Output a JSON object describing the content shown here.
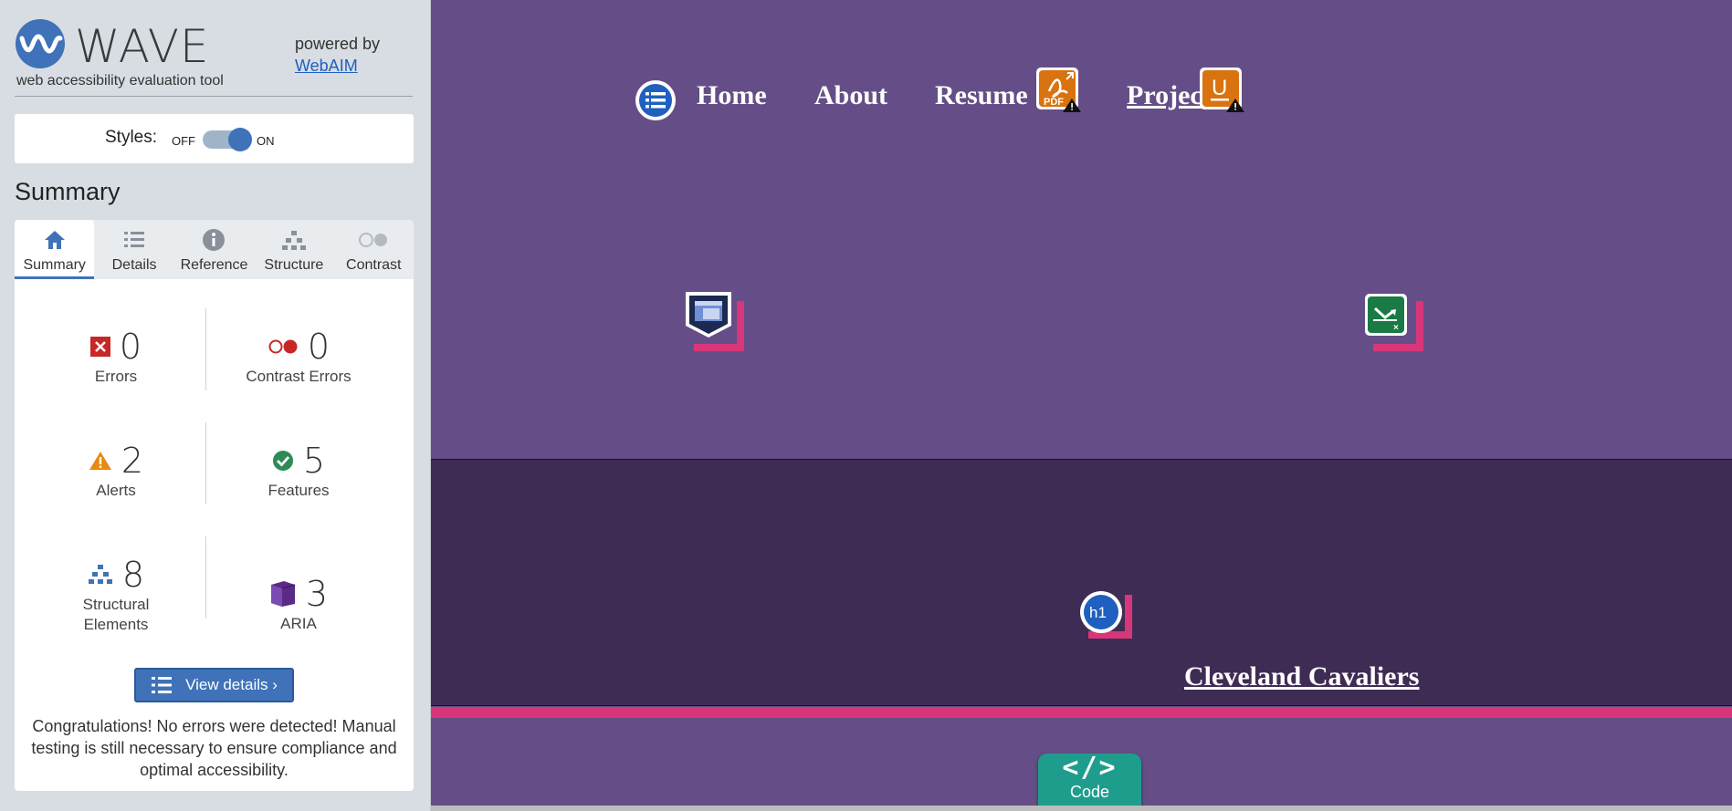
{
  "wave": {
    "brand": "WAVE",
    "tagline": "web accessibility evaluation tool",
    "powered_by": "powered by",
    "webaim_link": "WebAIM",
    "styles": {
      "label": "Styles:",
      "off": "OFF",
      "on": "ON",
      "enabled": true
    },
    "summary_heading": "Summary",
    "tabs": [
      {
        "label": "Summary",
        "icon": "home-icon",
        "active": true
      },
      {
        "label": "Details",
        "icon": "list-icon",
        "active": false
      },
      {
        "label": "Reference",
        "icon": "info-icon",
        "active": false
      },
      {
        "label": "Structure",
        "icon": "hierarchy-icon",
        "active": false
      },
      {
        "label": "Contrast",
        "icon": "contrast-icon",
        "active": false
      }
    ],
    "stats": {
      "errors": {
        "count": "0",
        "label": "Errors",
        "icon": "error-icon",
        "color": "#c62828"
      },
      "contrast_errors": {
        "count": "0",
        "label": "Contrast Errors",
        "icon": "contrast-error-icon",
        "color": "#c62828"
      },
      "alerts": {
        "count": "2",
        "label": "Alerts",
        "icon": "alert-icon",
        "color": "#e88a10"
      },
      "features": {
        "count": "5",
        "label": "Features",
        "icon": "feature-check-icon",
        "color": "#2e8b57"
      },
      "structural": {
        "count": "8",
        "label_line1": "Structural",
        "label_line2": "Elements",
        "icon": "structure-icon",
        "color": "#3f72b8"
      },
      "aria": {
        "count": "3",
        "label": "ARIA",
        "icon": "aria-cube-icon",
        "color": "#5b2a86"
      }
    },
    "view_details": "View details ›",
    "congrats": "Congratulations! No errors were detected! Manual testing is still necessary to ensure compliance and optimal accessibility."
  },
  "preview": {
    "colors": {
      "background": "#654e87",
      "hero": "#3f2c54",
      "accent_pink": "#d8367a"
    },
    "nav": [
      "Home",
      "About",
      "Resume",
      "Projects"
    ],
    "badges": {
      "nav_list": "list-icon",
      "resume": "pdf-link-alert-icon",
      "projects": "underline-alert-icon",
      "main_region": "region-icon",
      "skip_link": "skip-link-icon",
      "heading": "h1"
    },
    "hero_title": "Cleveland Cavaliers",
    "code_tab": {
      "glyph": "</>",
      "label": "Code"
    }
  }
}
